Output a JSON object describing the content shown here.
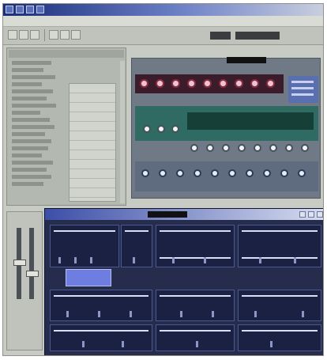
{
  "app": {
    "title": "",
    "menu": []
  },
  "toolbar": {
    "buttons": [
      "tool-button-1",
      "tool-button-2",
      "tool-button-3",
      "tool-button-4",
      "tool-button-5",
      "tool-button-6"
    ]
  },
  "rack": {
    "red_knobs": 9,
    "white_knobs": 12,
    "blue_knobs": 10
  },
  "colors": {
    "rack_red": "#8c2a45",
    "rack_green": "#2f6b63",
    "editor_bg": "#262d4c",
    "selection": "#6d7ee0"
  },
  "icons": [
    "window-icon",
    "close-icon",
    "minimize-icon",
    "maximize-icon",
    "knob-icon",
    "fader-icon"
  ]
}
